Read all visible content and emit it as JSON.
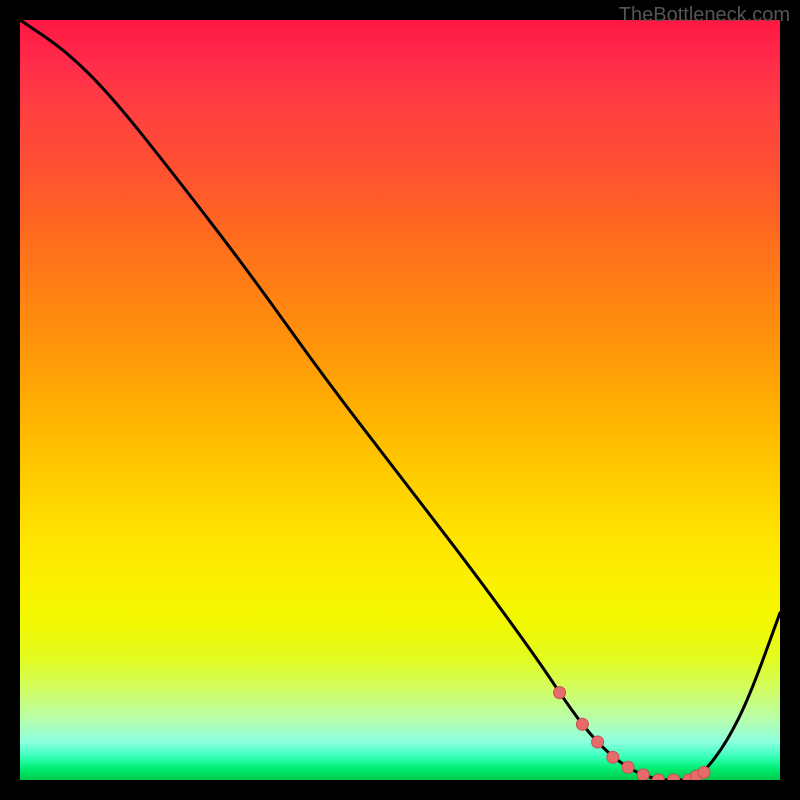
{
  "attribution": "TheBottleneck.com",
  "colors": {
    "curve": "#000000",
    "marker_fill": "#e86b6b",
    "marker_stroke": "#c94f4f"
  },
  "chart_data": {
    "type": "line",
    "title": "",
    "xlabel": "",
    "ylabel": "",
    "xlim": [
      0,
      100
    ],
    "ylim": [
      0,
      100
    ],
    "x": [
      0,
      6,
      12,
      20,
      30,
      40,
      50,
      60,
      68,
      72,
      75,
      78,
      81,
      84,
      86,
      88,
      90,
      93,
      96,
      100
    ],
    "values": [
      100,
      96,
      90,
      80,
      67,
      53,
      40,
      27,
      16,
      10,
      6,
      3,
      1,
      0,
      0,
      0,
      1,
      5,
      11,
      22
    ],
    "markers_x": [
      71,
      74,
      76,
      78,
      80,
      82,
      84,
      86,
      88,
      89,
      90
    ]
  }
}
